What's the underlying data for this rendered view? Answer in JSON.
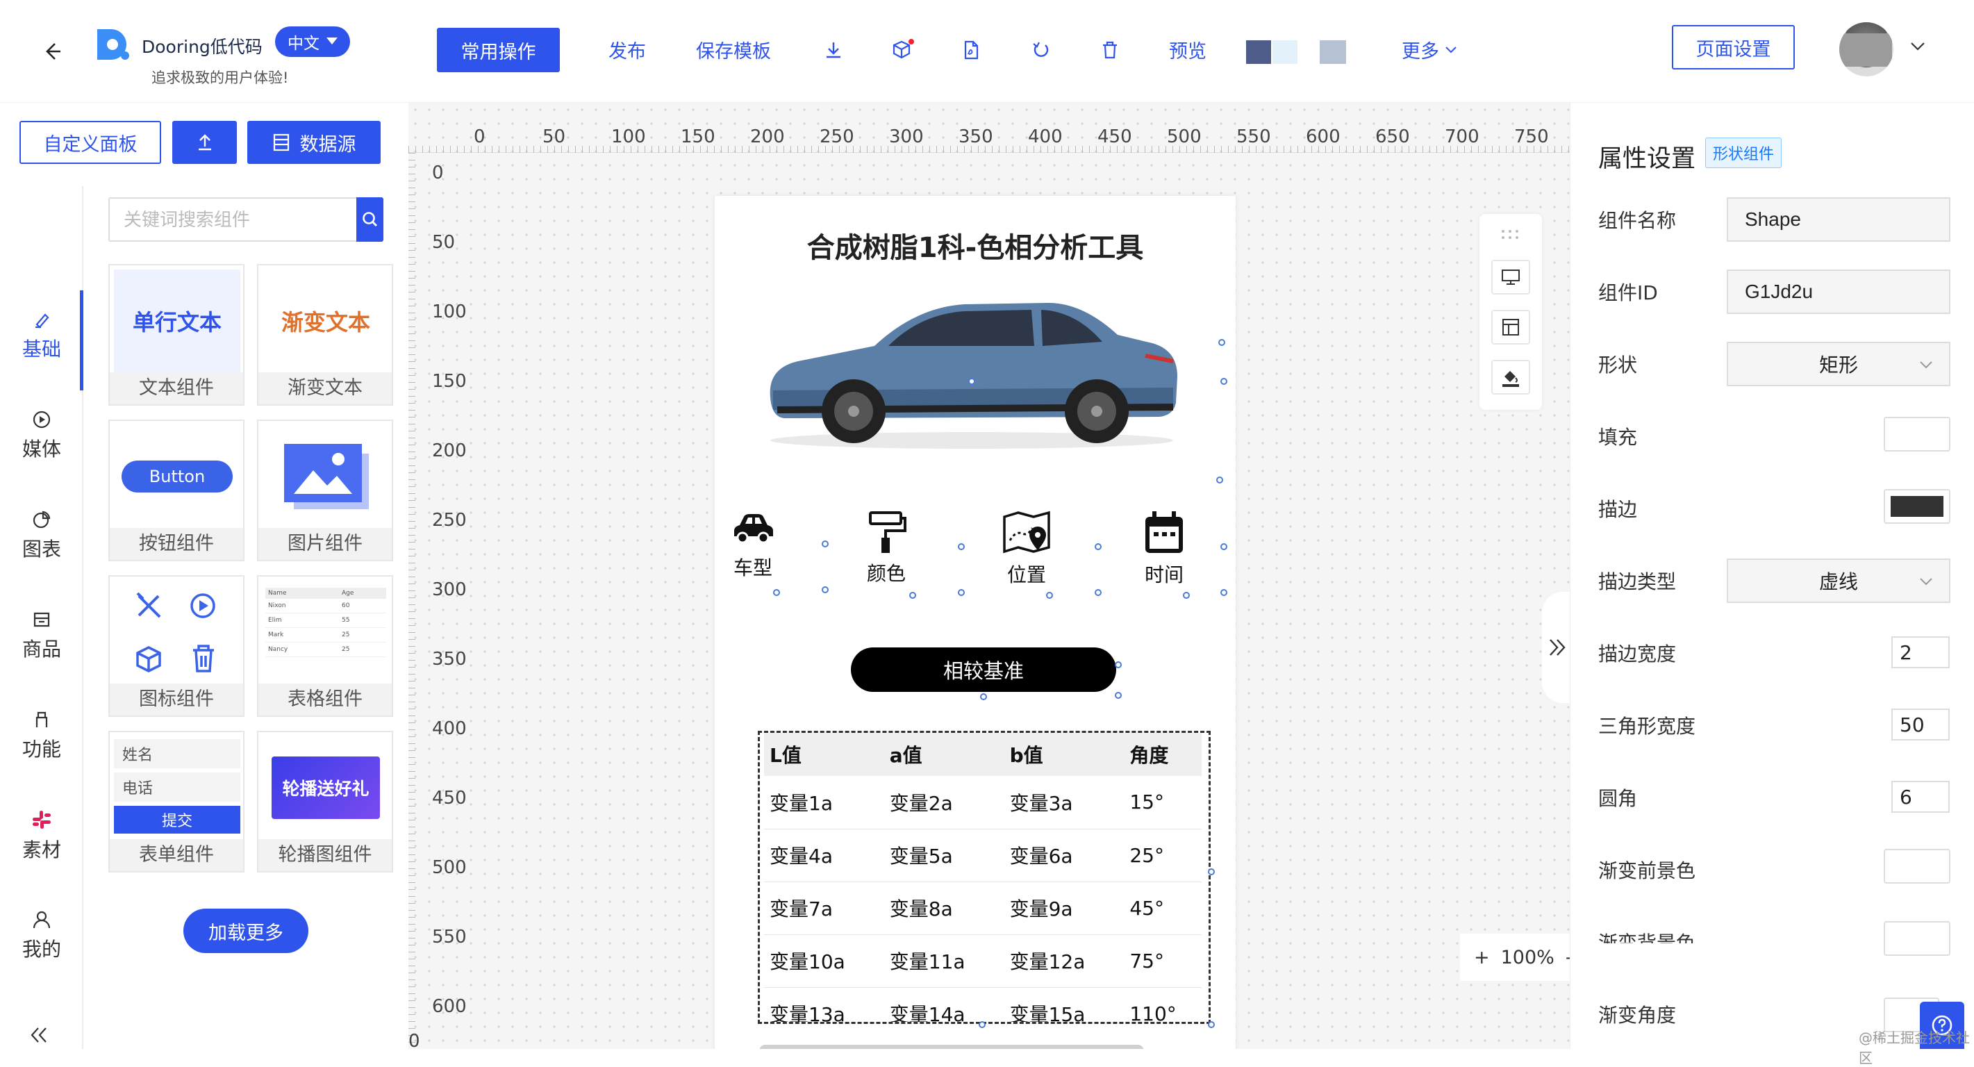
{
  "header": {
    "brand": "Dooring低代码",
    "lang": "中文",
    "slogan": "追求极致的用户体验!",
    "common_ops": "常用操作",
    "publish": "发布",
    "save_template": "保存模板",
    "preview": "预览",
    "more": "更多",
    "page_settings": "页面设置",
    "accent": "#2f54eb"
  },
  "left": {
    "custom_panel": "自定义面板",
    "datasource": "数据源",
    "search_placeholder": "关键词搜索组件",
    "load_more": "加载更多",
    "nav": [
      "基础",
      "媒体",
      "图表",
      "商品",
      "功能",
      "素材",
      "我的"
    ],
    "cards": {
      "text": {
        "preview": "单行文本",
        "label": "文本组件"
      },
      "gradient": {
        "preview": "渐变文本",
        "label": "渐变文本"
      },
      "button": {
        "preview": "Button",
        "label": "按钮组件"
      },
      "image": {
        "label": "图片组件"
      },
      "icon": {
        "label": "图标组件"
      },
      "table": {
        "label": "表格组件",
        "head": [
          "Name",
          "Age"
        ],
        "rows": [
          [
            "Nixon",
            "60"
          ],
          [
            "Elim",
            "55"
          ],
          [
            "Mark",
            "25"
          ],
          [
            "Nancy",
            "25"
          ]
        ]
      },
      "form": {
        "label": "表单组件",
        "name": "姓名",
        "phone": "电话",
        "submit": "提交"
      },
      "carousel": {
        "preview": "轮播送好礼",
        "label": "轮播图组件"
      }
    }
  },
  "canvas": {
    "ruler_x": [
      "0",
      "50",
      "100",
      "150",
      "200",
      "250",
      "300",
      "350",
      "400",
      "450",
      "500",
      "550",
      "600",
      "650",
      "700",
      "750"
    ],
    "ruler_y": [
      "0",
      "50",
      "100",
      "150",
      "200",
      "250",
      "300",
      "350",
      "400",
      "450",
      "500",
      "550",
      "600",
      "0"
    ],
    "title": "合成树脂1科-色相分析工具",
    "features": [
      "车型",
      "颜色",
      "位置",
      "时间"
    ],
    "compare_btn": "相较基准",
    "table": {
      "headers": [
        "L值",
        "a值",
        "b值",
        "角度"
      ],
      "rows": [
        [
          "变量1a",
          "变量2a",
          "变量3a",
          "15°"
        ],
        [
          "变量4a",
          "变量5a",
          "变量6a",
          "25°"
        ],
        [
          "变量7a",
          "变量8a",
          "变量9a",
          "45°"
        ],
        [
          "变量10a",
          "变量11a",
          "变量12a",
          "75°"
        ],
        [
          "变量13a",
          "变量14a",
          "变量15a",
          "110°"
        ]
      ]
    },
    "zoom": "100%",
    "zoom_plus": "+",
    "zoom_minus": "-"
  },
  "right": {
    "title": "属性设置",
    "badge": "形状组件",
    "labels": {
      "name": "组件名称",
      "id": "组件ID",
      "shape": "形状",
      "fill": "填充",
      "stroke": "描边",
      "stroke_type": "描边类型",
      "stroke_width": "描边宽度",
      "triangle_width": "三角形宽度",
      "radius": "圆角",
      "grad_fore": "渐变前景色",
      "grad_back": "渐变背景色",
      "grad_angle": "渐变角度"
    },
    "values": {
      "name": "Shape",
      "id": "G1Jd2u",
      "shape": "矩形",
      "stroke_type": "虚线",
      "stroke_width": "2",
      "triangle_width": "50",
      "radius": "6"
    },
    "colors": {
      "fill": "#ffffff",
      "stroke": "#333333"
    }
  },
  "watermark": "@稀土掘金技术社区"
}
